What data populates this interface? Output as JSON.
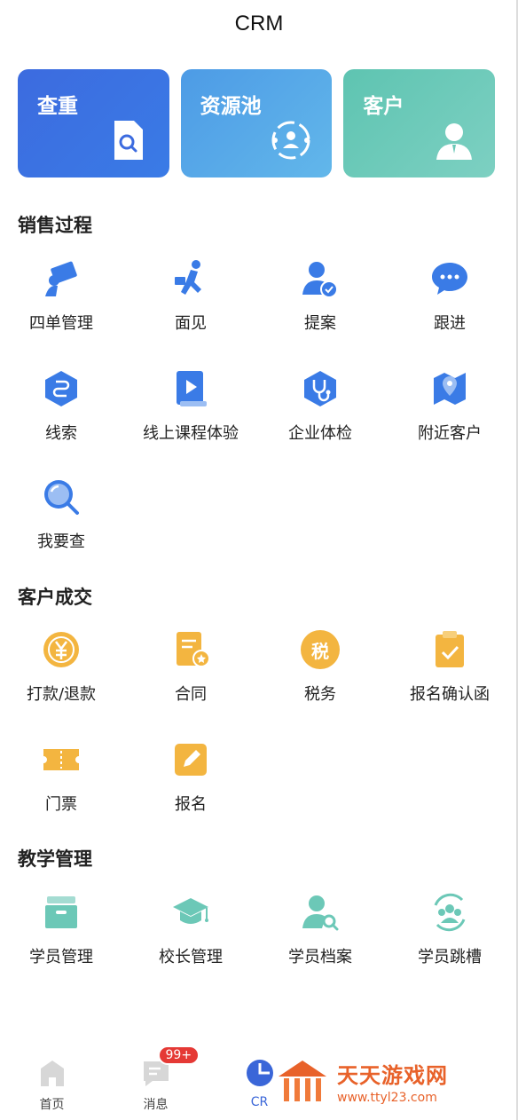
{
  "header": {
    "title": "CRM"
  },
  "top_cards": [
    {
      "label": "查重",
      "icon": "document-search-icon",
      "color": "#3c6bdf"
    },
    {
      "label": "资源池",
      "icon": "resource-pool-icon",
      "color": "#4d9be6"
    },
    {
      "label": "客户",
      "icon": "customer-icon",
      "color": "#5ec4b1"
    }
  ],
  "sections": {
    "sales": {
      "title": "销售过程",
      "items": [
        {
          "label": "四单管理",
          "icon": "order-manage-icon"
        },
        {
          "label": "面见",
          "icon": "running-person-icon"
        },
        {
          "label": "提案",
          "icon": "user-check-icon"
        },
        {
          "label": "跟进",
          "icon": "chat-bubble-icon"
        },
        {
          "label": "线索",
          "icon": "clue-hexagon-icon"
        },
        {
          "label": "线上课程体验",
          "icon": "video-book-icon"
        },
        {
          "label": "企业体检",
          "icon": "stethoscope-icon"
        },
        {
          "label": "附近客户",
          "icon": "map-pin-icon"
        },
        {
          "label": "我要查",
          "icon": "magnifier-icon"
        }
      ]
    },
    "deals": {
      "title": "客户成交",
      "items": [
        {
          "label": "打款/退款",
          "icon": "yen-coin-icon"
        },
        {
          "label": "合同",
          "icon": "contract-icon"
        },
        {
          "label": "税务",
          "icon": "tax-icon",
          "glyph": "税"
        },
        {
          "label": "报名确认函",
          "icon": "clipboard-check-icon"
        },
        {
          "label": "门票",
          "icon": "ticket-icon"
        },
        {
          "label": "报名",
          "icon": "edit-icon"
        }
      ]
    },
    "teaching": {
      "title": "教学管理",
      "items": [
        {
          "label": "学员管理",
          "icon": "archive-box-icon"
        },
        {
          "label": "校长管理",
          "icon": "graduation-cap-icon"
        },
        {
          "label": "学员档案",
          "icon": "user-search-icon"
        },
        {
          "label": "学员跳槽",
          "icon": "group-cycle-icon"
        }
      ]
    }
  },
  "tabbar": {
    "items": [
      {
        "label": "首页",
        "icon": "home-icon"
      },
      {
        "label": "消息",
        "icon": "message-icon",
        "badge": "99+"
      },
      {
        "label": "CR",
        "icon": "crm-pie-icon",
        "active": true
      }
    ]
  },
  "watermark": {
    "title": "天天游戏网",
    "url": "www.ttyl23.com"
  },
  "colors": {
    "blue": "#3a7be6",
    "orange": "#f3b540",
    "teal": "#6cc8b7",
    "accent": "#3a66d8"
  }
}
